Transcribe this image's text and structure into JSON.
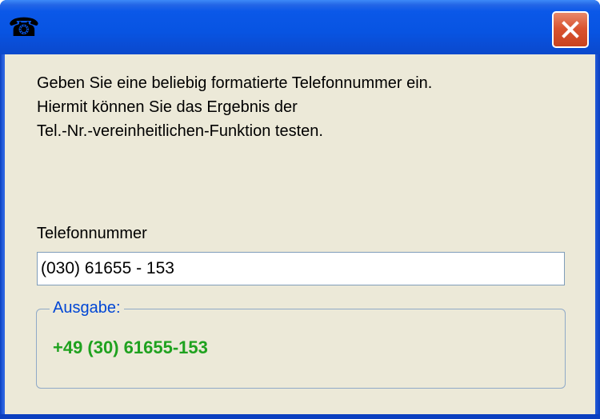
{
  "window": {
    "icon": "telephone-icon",
    "close_icon": "close-icon"
  },
  "description": {
    "line1": "Geben Sie eine beliebig formatierte Telefonnummer ein.",
    "line2": "Hiermit können Sie das Ergebnis der",
    "line3": "Tel.-Nr.-vereinheitlichen-Funktion testen."
  },
  "phone_field": {
    "label": "Telefonnummer",
    "value": "(030) 61655 - 153"
  },
  "output": {
    "legend": "Ausgabe:",
    "value": "+49 (30) 61655-153"
  },
  "colors": {
    "titlebar": "#0854e2",
    "client_background": "#ece9d8",
    "legend_text": "#0046d5",
    "output_text": "#1fa21f",
    "close_button": "#d9532f"
  }
}
